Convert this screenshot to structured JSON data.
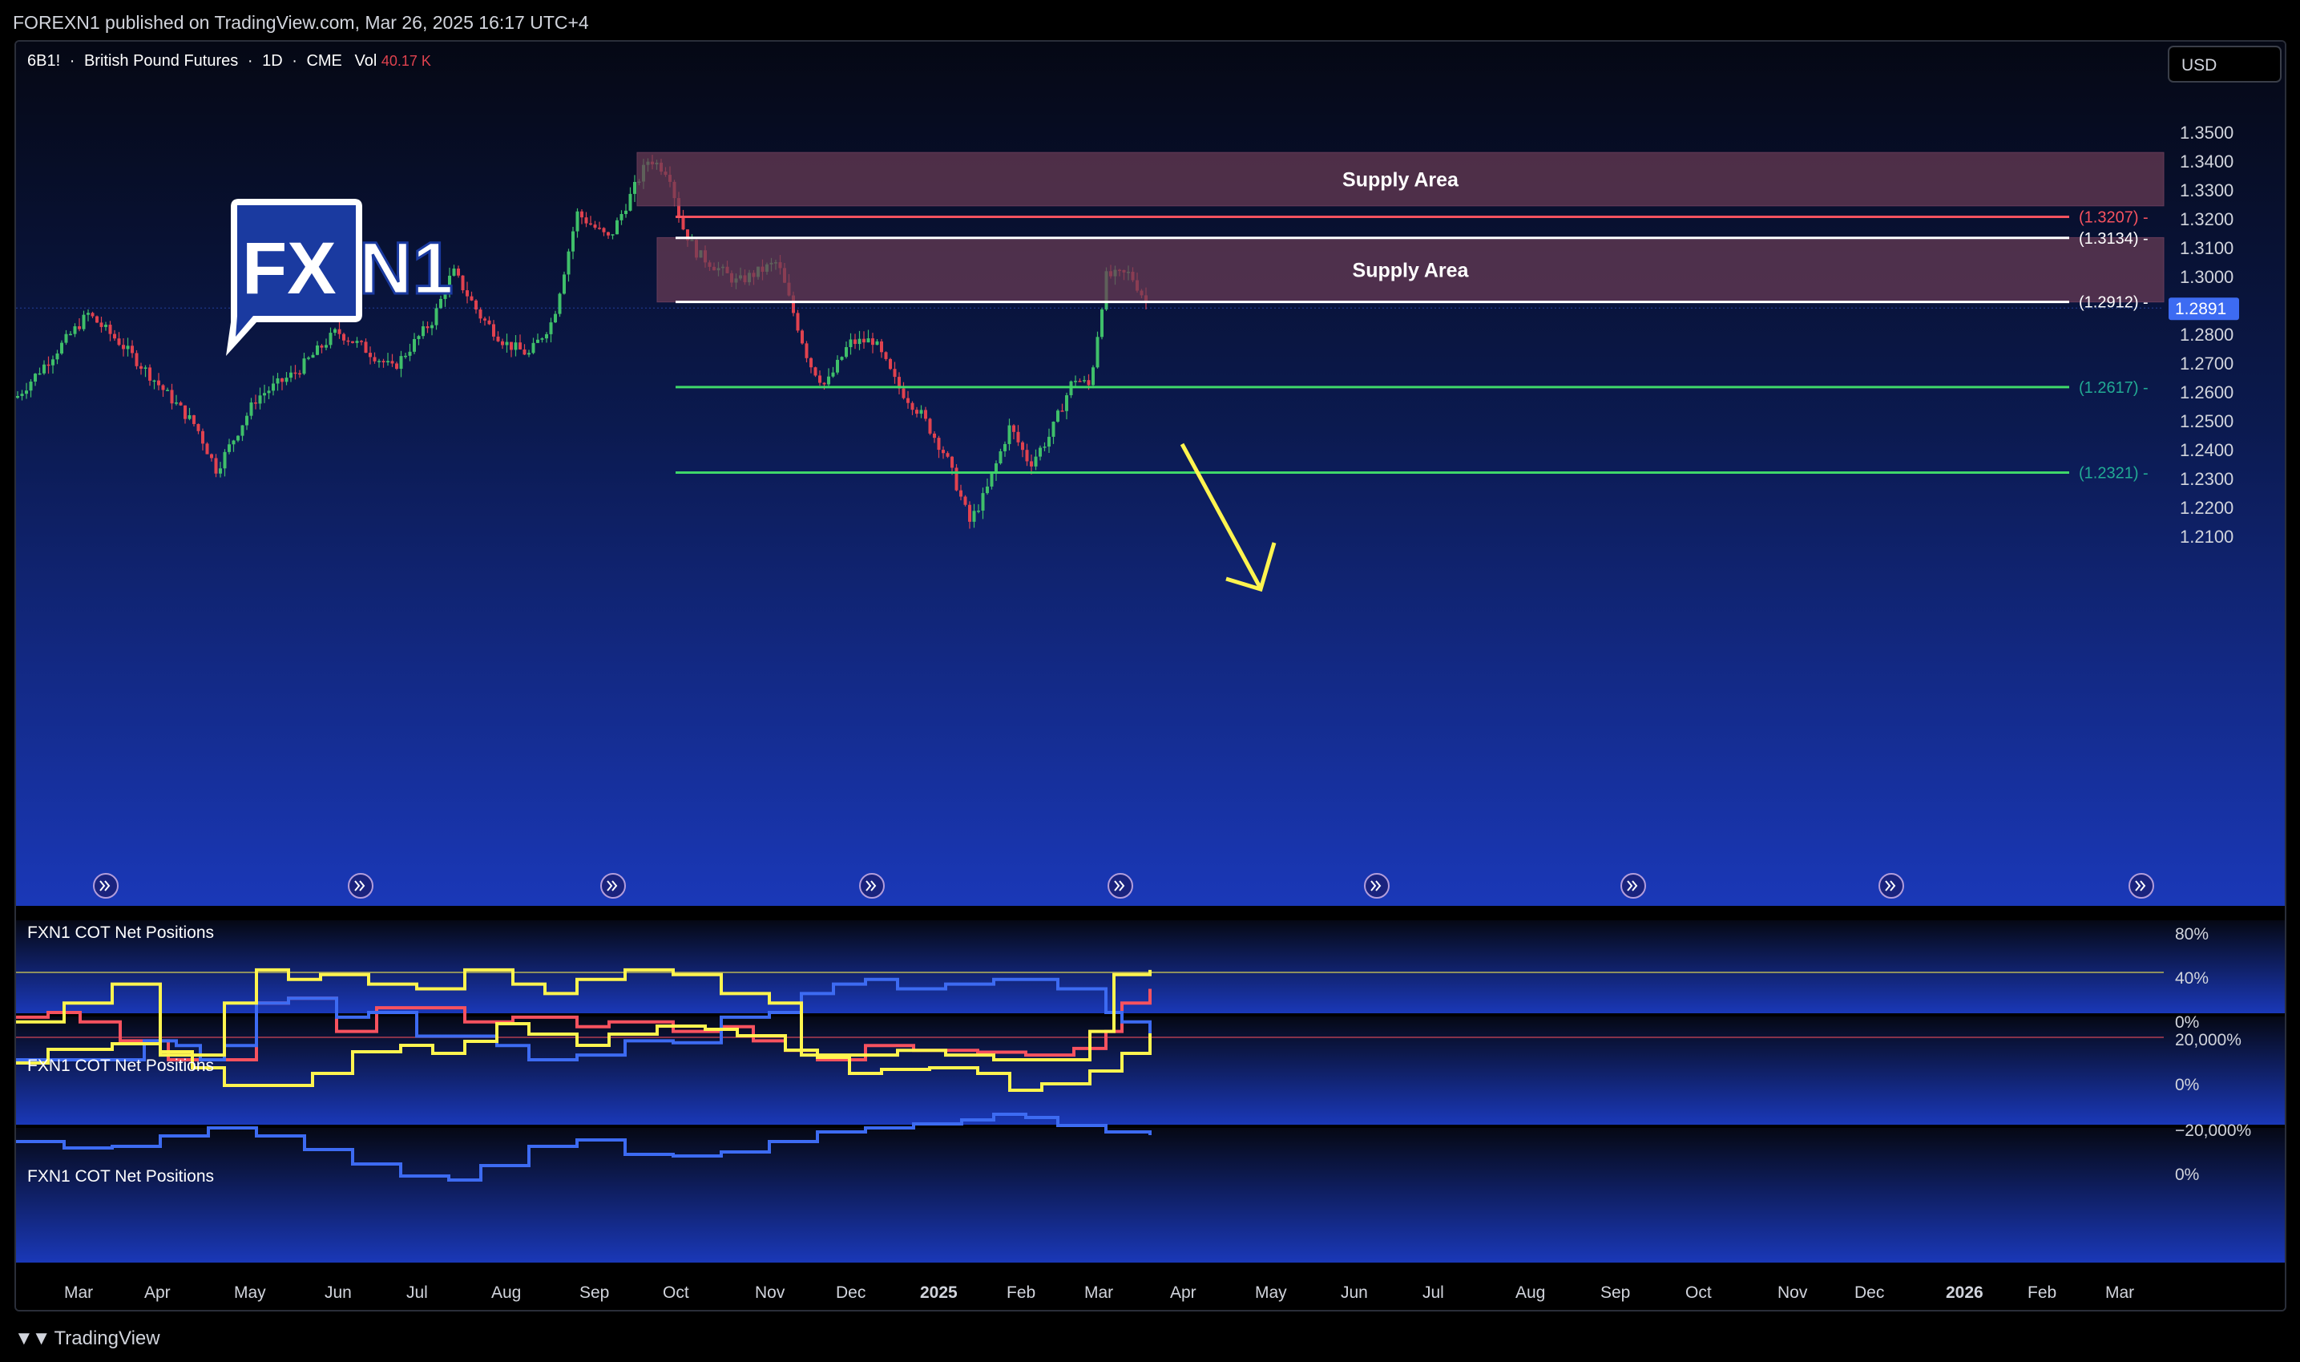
{
  "header": {
    "published": "FOREXN1 published on TradingView.com, Mar 26, 2025 16:17 UTC+4"
  },
  "symbol": {
    "ticker": "6B1!",
    "sep1": "·",
    "name": "British Pound Futures",
    "sep2": "·",
    "interval": "1D",
    "sep3": "·",
    "exchange": "CME",
    "vol_label": "Vol",
    "vol_value": "40.17 K"
  },
  "currency_button": "USD",
  "logo": {
    "fx": "FX",
    "n1": "N1"
  },
  "zones": [
    {
      "label": "Supply Area"
    },
    {
      "label": "Supply Area"
    }
  ],
  "levels": [
    {
      "label": "(1.3207)",
      "color": "#f7525f"
    },
    {
      "label": "(1.3134)",
      "color": "#ffffff"
    },
    {
      "label": "(1.2912)",
      "color": "#ffffff"
    },
    {
      "label": "(1.2617)",
      "color": "#22ab94"
    },
    {
      "label": "(1.2321)",
      "color": "#22ab94"
    }
  ],
  "current_price": "1.2891",
  "price_axis": [
    "1.3500",
    "1.3400",
    "1.3300",
    "1.3200",
    "1.3100",
    "1.3000",
    "1.2800",
    "1.2700",
    "1.2600",
    "1.2500",
    "1.2400",
    "1.2300",
    "1.2200",
    "1.2100"
  ],
  "panes": [
    {
      "title": "FXN1 COT Net Positions",
      "axis": [
        "80%",
        "40%",
        "0%"
      ]
    },
    {
      "title": "FXN1 COT Net Positions",
      "axis": [
        "20,000%",
        "0%",
        "−20,000%"
      ]
    },
    {
      "title": "FXN1 COT Net Positions",
      "axis": [
        "0%"
      ]
    }
  ],
  "time_axis": [
    {
      "label": "Mar",
      "bold": false
    },
    {
      "label": "Apr",
      "bold": false
    },
    {
      "label": "May",
      "bold": false
    },
    {
      "label": "Jun",
      "bold": false
    },
    {
      "label": "Jul",
      "bold": false
    },
    {
      "label": "Aug",
      "bold": false
    },
    {
      "label": "Sep",
      "bold": false
    },
    {
      "label": "Oct",
      "bold": false
    },
    {
      "label": "Nov",
      "bold": false
    },
    {
      "label": "Dec",
      "bold": false
    },
    {
      "label": "2025",
      "bold": true
    },
    {
      "label": "Feb",
      "bold": false
    },
    {
      "label": "Mar",
      "bold": false
    },
    {
      "label": "Apr",
      "bold": false
    },
    {
      "label": "May",
      "bold": false
    },
    {
      "label": "Jun",
      "bold": false
    },
    {
      "label": "Jul",
      "bold": false
    },
    {
      "label": "Aug",
      "bold": false
    },
    {
      "label": "Sep",
      "bold": false
    },
    {
      "label": "Oct",
      "bold": false
    },
    {
      "label": "Nov",
      "bold": false
    },
    {
      "label": "Dec",
      "bold": false
    },
    {
      "label": "2026",
      "bold": true
    },
    {
      "label": "Feb",
      "bold": false
    },
    {
      "label": "Mar",
      "bold": false
    }
  ],
  "footer": {
    "brand": "TradingView"
  },
  "colors": {
    "up": "#3fbf6a",
    "down": "#e0424f",
    "yellow": "#fff44f",
    "blue": "#3d6bf2",
    "red": "#f7525f",
    "supply": "#6a3c55"
  }
}
